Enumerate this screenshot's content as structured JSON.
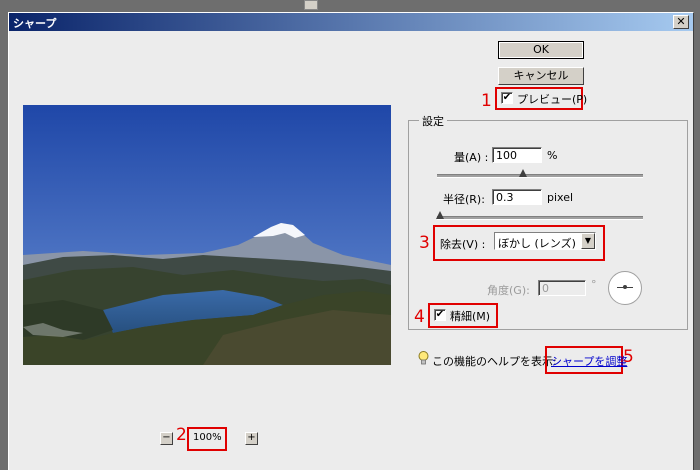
{
  "window": {
    "title": "シャープ",
    "close_symbol": "✕"
  },
  "buttons": {
    "ok": "OK",
    "cancel": "キャンセル"
  },
  "preview": {
    "label": "プレビュー(P)",
    "checked": true
  },
  "settings": {
    "group_label": "設定",
    "amount": {
      "label": "量(A) :",
      "value": "100",
      "unit": "%"
    },
    "radius": {
      "label": "半径(R):",
      "value": "0.3",
      "unit": "pixel"
    },
    "remove": {
      "label": "除去(V) :",
      "selected": "ぼかし (レンズ)"
    },
    "angle": {
      "label": "角度(G):",
      "value": "0",
      "unit": "°"
    },
    "more_accurate": {
      "label": "精細(M)",
      "checked": true
    }
  },
  "help": {
    "text": "この機能のヘルプを表示:",
    "link": "シャープを調整"
  },
  "zoom": {
    "value": "100%",
    "minus": "−",
    "plus": "+"
  },
  "annotations": [
    "1",
    "2",
    "3",
    "4",
    "5"
  ],
  "check_mark": "✔",
  "colors": {
    "annotation_red": "#e00000",
    "title_bar": "#0a246a",
    "link": "#0000cc"
  }
}
